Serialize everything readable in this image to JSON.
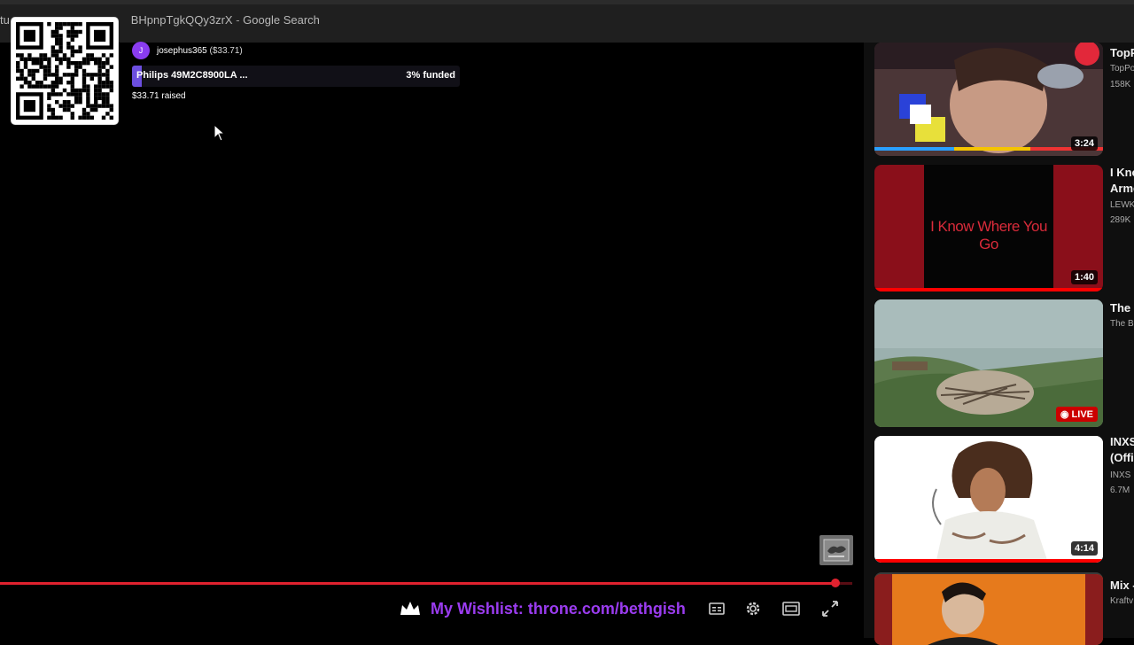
{
  "browser": {
    "tab_title_prefix": "tu.",
    "tab_title_id": "BHpnpTgkQQy3zrX",
    "tab_title_sep": " - ",
    "tab_title_suffix": "Google Search"
  },
  "donation": {
    "avatar_letter": "J",
    "donor_name": "josephus365",
    "donor_amount": "($33.71)",
    "goal_name": "Philips 49M2C8900LA ...",
    "goal_funded": "3% funded",
    "goal_fraction": 0.03,
    "raised": "$33.71 raised"
  },
  "player": {
    "progress_fraction": 0.98,
    "wishlist_text": "My Wishlist: throne.com/bethgish",
    "icons": [
      "crown-icon",
      "subtitles-icon",
      "settings-gear-icon",
      "miniplayer-icon",
      "fullscreen-icon"
    ]
  },
  "sidebar": {
    "videos": [
      {
        "title": "TopP",
        "channel": "TopPo",
        "meta": "158K",
        "duration": "3:24",
        "thumb_text": "",
        "live": false,
        "watched": 0.0
      },
      {
        "title": "I Kno",
        "title2": "Arme",
        "channel": "LEWK",
        "meta": "289K",
        "duration": "1:40",
        "thumb_text": "I Know Where You Go",
        "live": false,
        "watched": 1.0
      },
      {
        "title": "The I",
        "channel": "The B",
        "meta": "",
        "duration": "",
        "thumb_text": "",
        "live": true,
        "live_label": "LIVE",
        "watched": 0.0
      },
      {
        "title": "INXS",
        "title2": "(Offic",
        "channel": "INXS",
        "meta": "6.7M",
        "duration": "4:14",
        "thumb_text": "",
        "live": false,
        "watched": 1.0
      },
      {
        "title": "Mix -",
        "channel": "Kraftv",
        "meta": "",
        "duration": "",
        "thumb_text": "",
        "live": false,
        "watched": 0.0
      }
    ]
  },
  "colors": {
    "accent_purple": "#9b3cf0",
    "progress_red": "#e0222f",
    "youtube_red": "#ff0000"
  }
}
